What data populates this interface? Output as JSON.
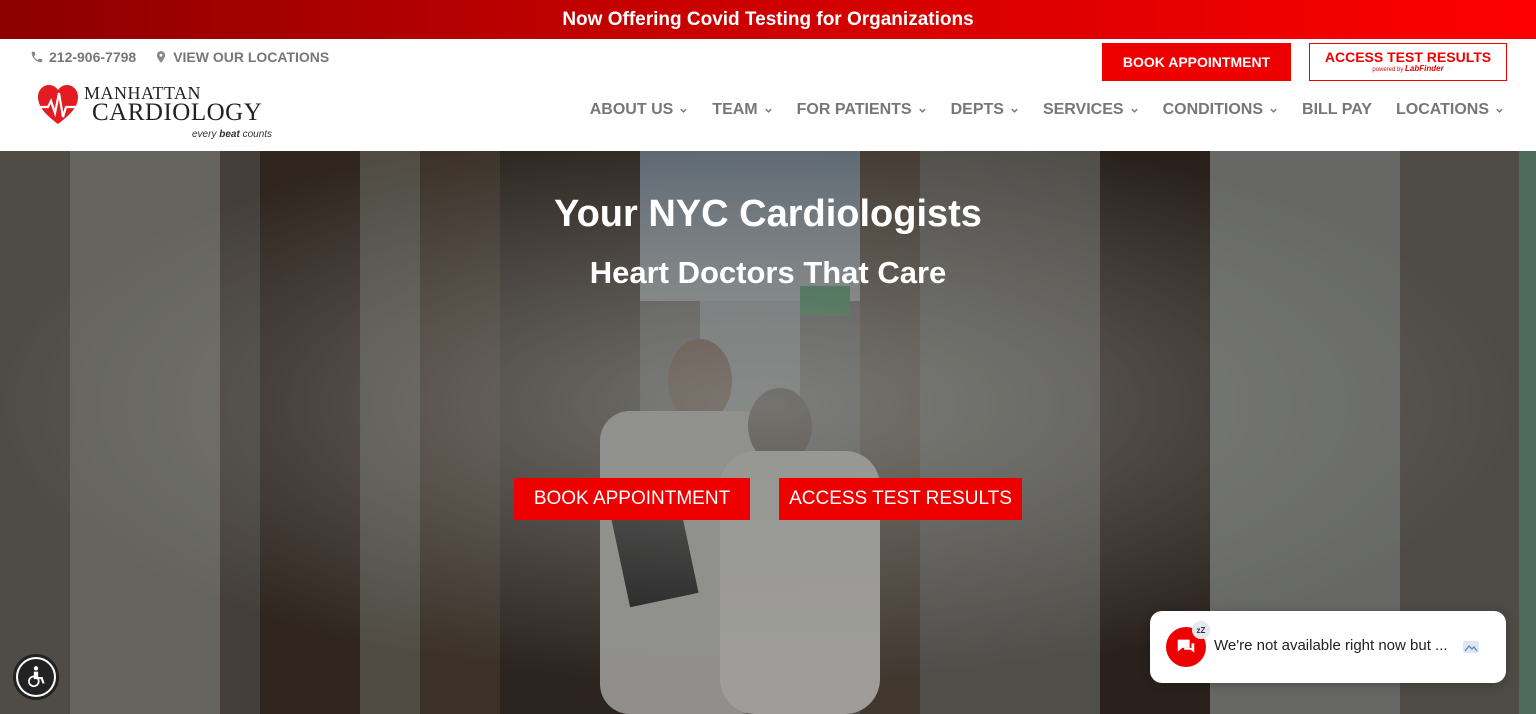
{
  "promo": {
    "text": "Now Offering Covid Testing for Organizations"
  },
  "header": {
    "phone": "212-906-7798",
    "locations_link": "VIEW OUR LOCATIONS",
    "logo": {
      "line1": "MANHATTAN",
      "line2": "CARDIOLOGY",
      "tagline_pre": "every ",
      "tagline_bold": "beat",
      "tagline_post": " counts"
    },
    "book_button": "BOOK APPOINTMENT",
    "results_button": {
      "label": "ACCESS TEST RESULTS",
      "powered_by": "powered by",
      "brand": "LabFinder"
    },
    "nav": [
      {
        "label": "ABOUT US",
        "dropdown": true
      },
      {
        "label": "TEAM",
        "dropdown": true
      },
      {
        "label": "FOR PATIENTS",
        "dropdown": true
      },
      {
        "label": "DEPTS",
        "dropdown": true
      },
      {
        "label": "SERVICES",
        "dropdown": true
      },
      {
        "label": "CONDITIONS",
        "dropdown": true
      },
      {
        "label": "BILL PAY",
        "dropdown": false
      },
      {
        "label": "LOCATIONS",
        "dropdown": true
      }
    ]
  },
  "hero": {
    "title": "Your NYC Cardiologists",
    "subtitle": "Heart Doctors That Care",
    "book_button": "BOOK APPOINTMENT",
    "results_button": "ACCESS TEST RESULTS"
  },
  "chat": {
    "message": "We're not available right now but ...",
    "status_badge": "zZ"
  },
  "colors": {
    "accent": "#ee0000",
    "nav_text": "#777777",
    "promo_dark": "#8b0000"
  },
  "icons": [
    "phone-icon",
    "map-pin-icon",
    "heart-logo-icon",
    "chevron-down-icon",
    "accessibility-icon",
    "chat-icon",
    "image-icon"
  ]
}
